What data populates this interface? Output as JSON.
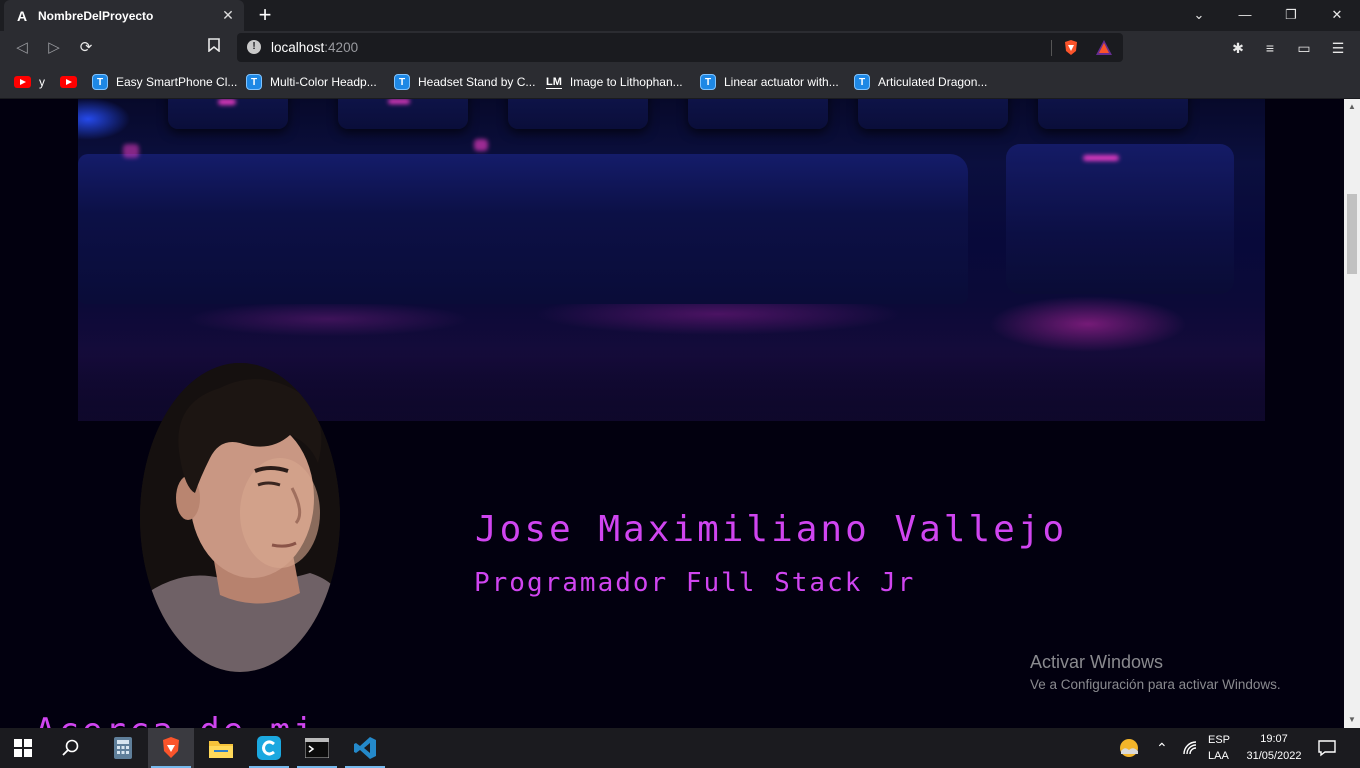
{
  "browser": {
    "tab_title": "NombreDelProyecto",
    "tab_favicon": "A",
    "url_host": "localhost",
    "url_port": ":4200"
  },
  "bookmarks": [
    {
      "label": "y",
      "icon": "youtube-icon"
    },
    {
      "label": "",
      "icon": "youtube-icon"
    },
    {
      "label": "Easy SmartPhone Cl...",
      "icon": "thingiverse-icon"
    },
    {
      "label": "Multi-Color Headp...",
      "icon": "thingiverse-icon"
    },
    {
      "label": "Headset Stand by C...",
      "icon": "thingiverse-icon"
    },
    {
      "label": "Image to Lithophan...",
      "icon": "lithophane-icon",
      "icon_text": "LM"
    },
    {
      "label": "Linear actuator with...",
      "icon": "thingiverse-icon"
    },
    {
      "label": "Articulated Dragon...",
      "icon": "thingiverse-icon"
    }
  ],
  "page": {
    "name": "Jose Maximiliano Vallejo",
    "role": "Programador Full Stack Jr",
    "next_heading": "Acerca de mi"
  },
  "watermark": {
    "title": "Activar Windows",
    "subtitle": "Ve a Configuración para activar Windows."
  },
  "tray": {
    "lang_top": "ESP",
    "lang_bottom": "LAA",
    "time": "19:07",
    "date": "31/05/2022"
  },
  "colors": {
    "accent_text": "#d045f0",
    "page_bg": "#02000f"
  }
}
